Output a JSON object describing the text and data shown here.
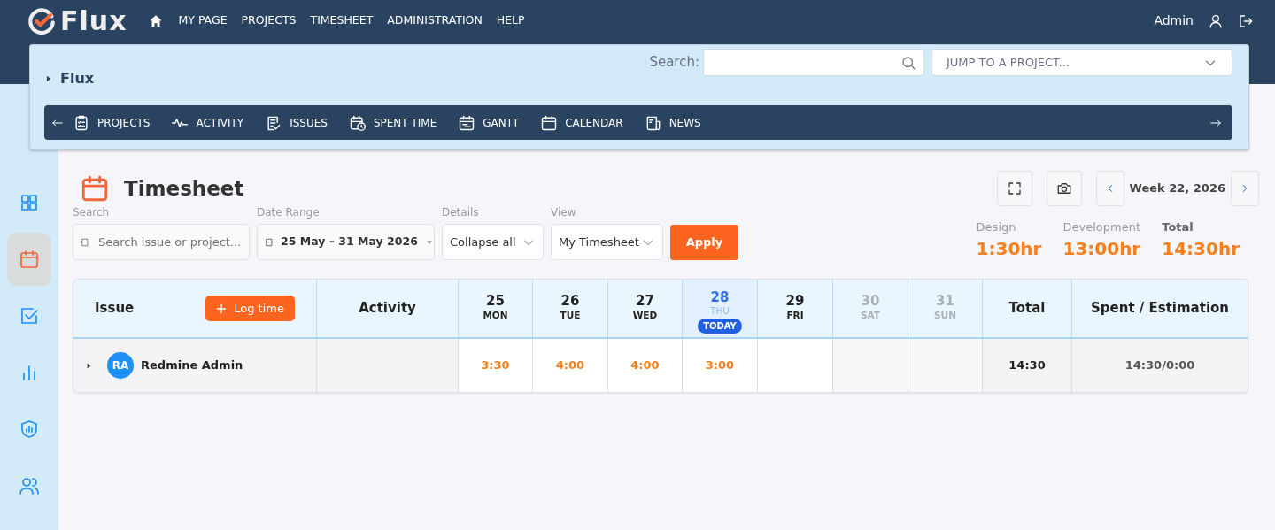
{
  "brand": {
    "name": "Flux"
  },
  "top_menu": [
    {
      "label": "MY PAGE"
    },
    {
      "label": "PROJECTS"
    },
    {
      "label": "TIMESHEET"
    },
    {
      "label": "ADMINISTRATION"
    },
    {
      "label": "HELP"
    }
  ],
  "user": {
    "name": "Admin"
  },
  "project_header": {
    "title": "Flux",
    "search_label": "Search:",
    "jump_placeholder": "JUMP TO A PROJECT..."
  },
  "project_menu": [
    {
      "label": "PROJECTS"
    },
    {
      "label": "ACTIVITY"
    },
    {
      "label": "ISSUES"
    },
    {
      "label": "SPENT TIME"
    },
    {
      "label": "GANTT"
    },
    {
      "label": "CALENDAR"
    },
    {
      "label": "NEWS"
    }
  ],
  "sidebar": {
    "items": [
      {
        "selected": false
      },
      {
        "selected": true
      },
      {
        "selected": false
      },
      {
        "selected": false
      },
      {
        "selected": false
      },
      {
        "selected": false
      }
    ]
  },
  "page": {
    "title": "Timesheet",
    "week": "Week 22, 2026"
  },
  "filters": {
    "search_label": "Search",
    "search_placeholder": "Search issue or project...",
    "range_label": "Date Range",
    "range_value": "25 May – 31 May 2026",
    "details_label": "Details",
    "details_value": "Collapse all",
    "view_label": "View",
    "view_value": "My Timesheet",
    "apply": "Apply"
  },
  "summary": [
    {
      "label": "Design",
      "value": "1:30hr"
    },
    {
      "label": "Development",
      "value": "13:00hr"
    },
    {
      "label": "Total",
      "value": "14:30hr"
    }
  ],
  "table": {
    "issue_header": "Issue",
    "log_button": "Log time",
    "activity_header": "Activity",
    "total_header": "Total",
    "spent_header": "Spent / Estimation",
    "today_badge": "TODAY",
    "days": [
      {
        "date": "25",
        "weekday": "MON",
        "today": false,
        "weekend": false
      },
      {
        "date": "26",
        "weekday": "TUE",
        "today": false,
        "weekend": false
      },
      {
        "date": "27",
        "weekday": "WED",
        "today": false,
        "weekend": false
      },
      {
        "date": "28",
        "weekday": "THU",
        "today": true,
        "weekend": false
      },
      {
        "date": "29",
        "weekday": "FRI",
        "today": false,
        "weekend": false
      },
      {
        "date": "30",
        "weekday": "SAT",
        "today": false,
        "weekend": true
      },
      {
        "date": "31",
        "weekday": "SUN",
        "today": false,
        "weekend": true
      }
    ],
    "rows": [
      {
        "initials": "RA",
        "name": "Redmine Admin",
        "expanded": false,
        "hours": [
          "3:30",
          "4:00",
          "4:00",
          "3:00"
        ],
        "total": "14:30",
        "spent": "14:30/0:00"
      }
    ]
  }
}
